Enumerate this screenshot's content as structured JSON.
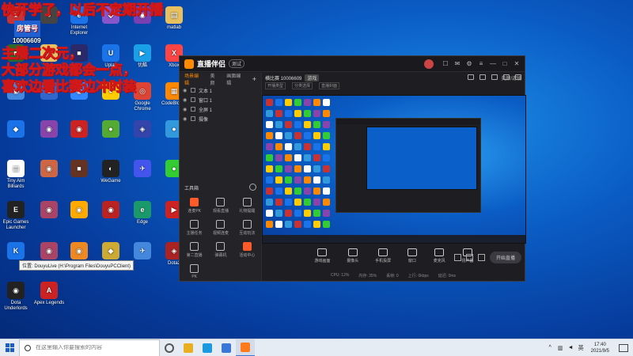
{
  "overlay_text": {
    "line1": "快开学了，以后不定期开播",
    "line2": "主播二次元，",
    "line3": "大部分游戏都会一点，",
    "line4": "喜欢边看比赛边冲时装",
    "badge": "房管号",
    "uid": "10006609"
  },
  "desktop_icons": [
    {
      "label": "",
      "color": "#c83232",
      "glyph": "■"
    },
    {
      "label": "",
      "color": "#444444",
      "glyph": "●"
    },
    {
      "label": "Internet Explorer",
      "color": "#1a73e8",
      "glyph": "e"
    },
    {
      "label": "",
      "color": "#8855cc",
      "glyph": "◆"
    },
    {
      "label": "",
      "color": "#7a3fb0",
      "glyph": "◉"
    },
    {
      "label": "matlab",
      "color": "#e8c060",
      "glyph": "▤"
    },
    {
      "label": "",
      "color": "#2a6a2a",
      "glyph": "■"
    },
    {
      "label": "",
      "color": "#e8c060",
      "glyph": "▤"
    },
    {
      "label": "",
      "color": "#2a2a6a",
      "glyph": "■"
    },
    {
      "label": "Uplay",
      "color": "#1a73e8",
      "glyph": "U"
    },
    {
      "label": "优酷",
      "color": "#1aa0e8",
      "glyph": "▶"
    },
    {
      "label": "Xbox",
      "color": "#ff4444",
      "glyph": "X"
    },
    {
      "label": "",
      "color": "#4488dd",
      "glyph": "◉"
    },
    {
      "label": "",
      "color": "#3366cc",
      "glyph": "♞"
    },
    {
      "label": "",
      "color": "#3388ff",
      "glyph": "◉"
    },
    {
      "label": "",
      "color": "#ffcc00",
      "glyph": "●"
    },
    {
      "label": "Google Chrome",
      "color": "#dd4433",
      "glyph": "◎"
    },
    {
      "label": "CodeBlocks",
      "color": "#ff8800",
      "glyph": "▦"
    },
    {
      "label": "",
      "color": "#1a73e8",
      "glyph": "◆"
    },
    {
      "label": "",
      "color": "#8844aa",
      "glyph": "◉"
    },
    {
      "label": "",
      "color": "#cc2222",
      "glyph": "◉"
    },
    {
      "label": "",
      "color": "#55aa33",
      "glyph": "●"
    },
    {
      "label": "",
      "color": "#3344aa",
      "glyph": "◈"
    },
    {
      "label": "",
      "color": "#3399dd",
      "glyph": "●"
    },
    {
      "label": "Tiny Aim Billiards",
      "color": "#ffffff",
      "glyph": "▤"
    },
    {
      "label": "",
      "color": "#cc6644",
      "glyph": "◉"
    },
    {
      "label": "",
      "color": "#663322",
      "glyph": "■"
    },
    {
      "label": "WeGame",
      "color": "#222222",
      "glyph": "◐"
    },
    {
      "label": "",
      "color": "#4455ee",
      "glyph": "✈"
    },
    {
      "label": "",
      "color": "#33cc33",
      "glyph": "●"
    },
    {
      "label": "Epic Games Launcher",
      "color": "#222222",
      "glyph": "E"
    },
    {
      "label": "",
      "color": "#aa4466",
      "glyph": "◉"
    },
    {
      "label": "",
      "color": "#ffaa00",
      "glyph": "◉"
    },
    {
      "label": "",
      "color": "#bb2222",
      "glyph": "◉"
    },
    {
      "label": "Edge",
      "color": "#1a9a6a",
      "glyph": "e"
    },
    {
      "label": "",
      "color": "#cc2222",
      "glyph": "▶"
    },
    {
      "label": "",
      "color": "#1a73e8",
      "glyph": "K"
    },
    {
      "label": "",
      "color": "#aa4466",
      "glyph": "◉"
    },
    {
      "label": "",
      "color": "#ee8822",
      "glyph": "◉"
    },
    {
      "label": "",
      "color": "#ccaa33",
      "glyph": "◆"
    },
    {
      "label": "",
      "color": "#4488dd",
      "glyph": "✈"
    },
    {
      "label": "Dota2",
      "color": "#aa2222",
      "glyph": "◈"
    },
    {
      "label": "Dota Underlords",
      "color": "#222222",
      "glyph": "◉"
    },
    {
      "label": "Apex Legends",
      "color": "#cc2222",
      "glyph": "A"
    }
  ],
  "app": {
    "title": "直播伴侣",
    "beta": "测试",
    "left_tabs": [
      "场景编辑",
      "美颜",
      "画面编辑"
    ],
    "scenes": [
      "文本 1",
      "窗口 1",
      "全屏 1",
      "摄像"
    ],
    "toolbox_title": "工具箱",
    "tools": [
      "连麦PK",
      "观看直播",
      "礼物提醒",
      "主播任务",
      "视频连麦",
      "互动玩法",
      "第二直播",
      "弹幕机",
      "活动中心",
      "PK"
    ],
    "stream_title": "横比赛 10006609",
    "stream_badge": "游戏",
    "stream_right": "美颜/滤镜",
    "stream_sub": [
      "开播类型",
      "分类选择",
      "直播封面"
    ],
    "bottom_tools": [
      "游戏画面",
      "摄像头",
      "手机投屏",
      "窗口",
      "麦克风",
      "扬声器"
    ],
    "start_button": "开始直播",
    "status": [
      "CPU: 12%",
      "内存: 35%",
      "丢帧: 0",
      "上行: 0kbps",
      "延迟: 0ms"
    ]
  },
  "tooltip": "位置: DouyuLive (H:\\Program Files\\DouyuPCClient)",
  "taskbar": {
    "search_placeholder": "在这里输入你要搜索的内容",
    "time": "17:40",
    "date": "2021/9/5",
    "ime": "英",
    "apps": [
      {
        "name": "task-view",
        "color": "#555555"
      },
      {
        "name": "task-app-file-explorer",
        "color": "#e8b020"
      },
      {
        "name": "task-app-edge",
        "color": "#1a9ae0"
      },
      {
        "name": "task-app-store",
        "color": "#3a78d8"
      },
      {
        "name": "task-app-douyu",
        "color": "#ff7a1a"
      }
    ]
  },
  "colors": {
    "accent": "#ff8a00",
    "hot": "#ff5a2a",
    "overlay_stroke": "#d01818"
  }
}
